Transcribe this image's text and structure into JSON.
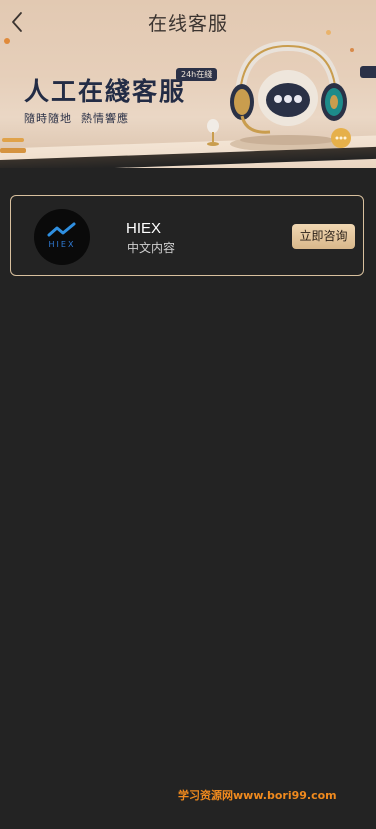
{
  "header": {
    "title": "在线客服"
  },
  "banner": {
    "headline": "人工在綫客服",
    "badge": "24h在綫",
    "subtitle": "隨時隨地  熱情響應"
  },
  "agents": [
    {
      "name": "HIEX",
      "description": "中文内容",
      "logo_text": "HIEX",
      "button_label": "立即咨询"
    }
  ],
  "watermark": "学习资源网www.bori99.com",
  "colors": {
    "background": "#232323",
    "card_border": "#d8c09e",
    "button_gold": "#d9b88b",
    "banner_beige": "#e2c9b2",
    "watermark_orange": "#f08a1e"
  },
  "icons": {
    "back": "chevron-left-icon",
    "headset": "headset-robot-icon"
  }
}
